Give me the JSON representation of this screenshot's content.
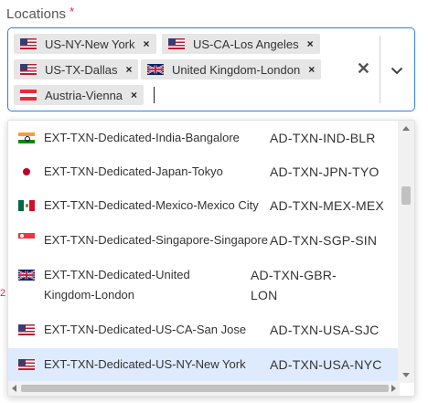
{
  "field": {
    "label": "Locations",
    "required_marker": "*"
  },
  "selected_chips": [
    {
      "label": "US-NY-New York",
      "flag": "us-flag-icon"
    },
    {
      "label": "US-CA-Los Angeles",
      "flag": "us-flag-icon"
    },
    {
      "label": "US-TX-Dallas",
      "flag": "us-flag-icon"
    },
    {
      "label": "United Kingdom-London",
      "flag": "uk-flag-icon"
    },
    {
      "label": "Austria-Vienna",
      "flag": "austria-flag-icon"
    }
  ],
  "controls": {
    "remove_glyph": "×",
    "clear_glyph": "✕",
    "clear_icon": "clear-icon",
    "toggle_icon": "chevron-down-icon"
  },
  "options": [
    {
      "label": "EXT-TXN-Dedicated-India-Bangalore",
      "code": "AD-TXN-IND-BLR",
      "flag": "india-flag-icon"
    },
    {
      "label": "EXT-TXN-Dedicated-Japan-Tokyo",
      "code": "AD-TXN-JPN-TYO",
      "flag": "japan-flag-icon"
    },
    {
      "label": "EXT-TXN-Dedicated-Mexico-Mexico City",
      "code": "AD-TXN-MEX-MEX",
      "flag": "mexico-flag-icon"
    },
    {
      "label": "EXT-TXN-Dedicated-Singapore-Singapore",
      "code": "AD-TXN-SGP-SIN",
      "flag": "singapore-flag-icon"
    },
    {
      "label": "EXT-TXN-Dedicated-United Kingdom-London",
      "code": "AD-TXN-GBR-LON",
      "flag": "uk-flag-icon"
    },
    {
      "label": "EXT-TXN-Dedicated-US-CA-San Jose",
      "code": "AD-TXN-USA-SJC",
      "flag": "us-flag-icon"
    },
    {
      "label": "EXT-TXN-Dedicated-US-NY-New York",
      "code": "AD-TXN-USA-NYC",
      "flag": "us-flag-icon",
      "highlighted": true
    }
  ],
  "side_mark": "2",
  "colors": {
    "focus_border": "#2f7fe6",
    "chip_bg": "#e6e6e6",
    "highlight_bg": "#deebff",
    "required": "#e0245e"
  }
}
